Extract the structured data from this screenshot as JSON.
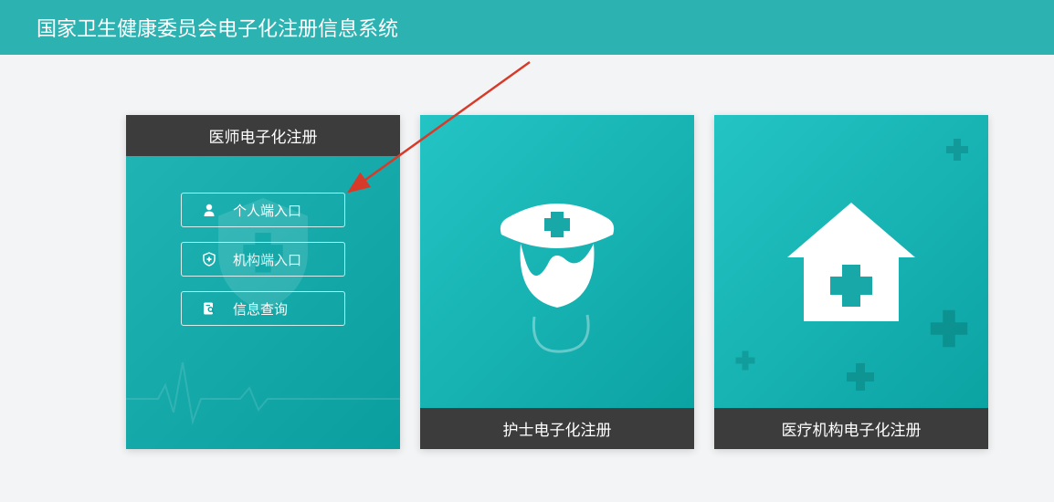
{
  "header": {
    "title": "国家卫生健康委员会电子化注册信息系统"
  },
  "cards": {
    "doctor": {
      "title": "医师电子化注册",
      "buttons": {
        "personal": "个人端入口",
        "org": "机构端入口",
        "query": "信息查询"
      }
    },
    "nurse": {
      "title": "护士电子化注册"
    },
    "facility": {
      "title": "医疗机构电子化注册"
    }
  }
}
